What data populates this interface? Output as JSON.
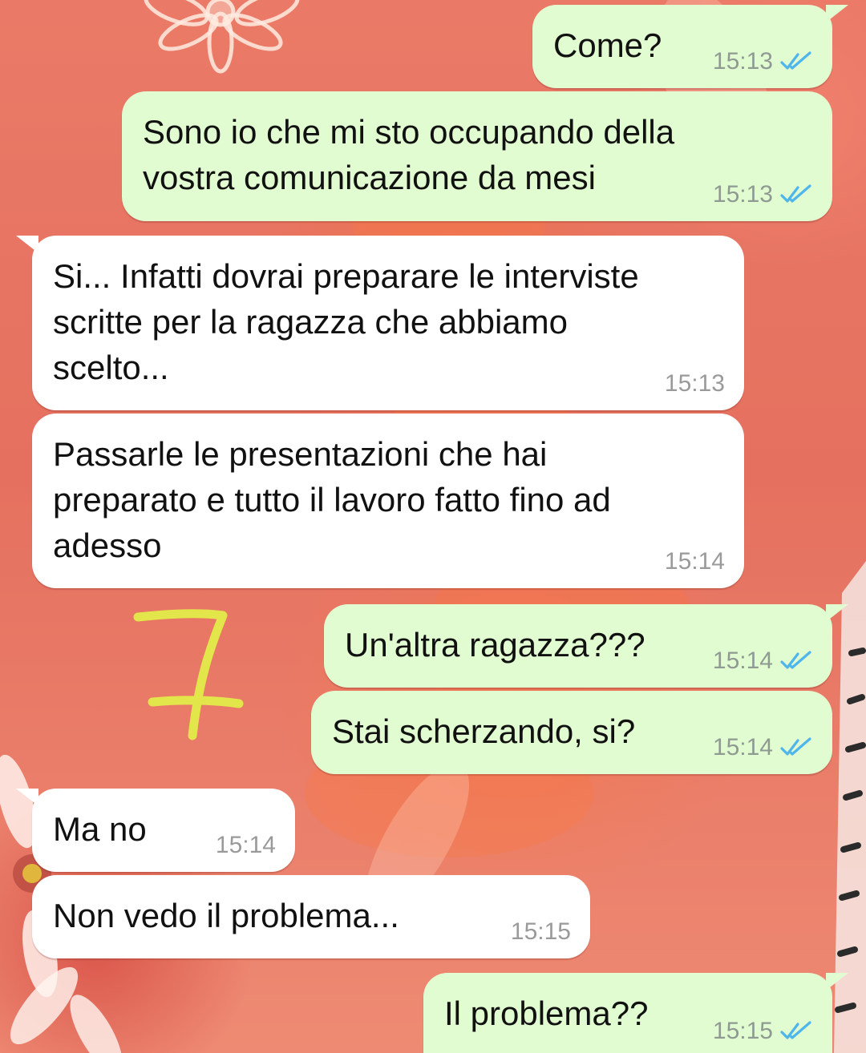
{
  "chat": {
    "messages": [
      {
        "id": "m1",
        "direction": "out",
        "text": "Come?",
        "time": "15:13",
        "status": "read"
      },
      {
        "id": "m2",
        "direction": "out",
        "text": "Sono io che mi sto occupando della\nvostra comunicazione da mesi",
        "time": "15:13",
        "status": "read"
      },
      {
        "id": "m3",
        "direction": "in",
        "text": "Si... Infatti dovrai preparare le interviste\nscritte per la ragazza che abbiamo\nscelto...",
        "time": "15:13"
      },
      {
        "id": "m4",
        "direction": "in",
        "text": "Passarle le presentazioni che hai\npreparato e tutto il lavoro fatto fino ad\nadesso",
        "time": "15:14"
      },
      {
        "id": "m5",
        "direction": "out",
        "text": "Un'altra ragazza???",
        "time": "15:14",
        "status": "read"
      },
      {
        "id": "m6",
        "direction": "out",
        "text": "Stai scherzando, si?",
        "time": "15:14",
        "status": "read"
      },
      {
        "id": "m7",
        "direction": "in",
        "text": "Ma no",
        "time": "15:14"
      },
      {
        "id": "m8",
        "direction": "in",
        "text": "Non vedo il problema...",
        "time": "15:15"
      },
      {
        "id": "m9",
        "direction": "out",
        "text": "Il problema??",
        "time": "15:15",
        "status": "read"
      }
    ]
  },
  "annotation": {
    "text": "7",
    "color": "#e2e64a"
  },
  "colors": {
    "outgoing_bubble": "#e2fcd1",
    "incoming_bubble": "#ffffff",
    "read_ticks": "#4fb6ec",
    "timestamp": "#8f9a93"
  },
  "icons": {
    "read_receipt": "double-check-icon"
  }
}
